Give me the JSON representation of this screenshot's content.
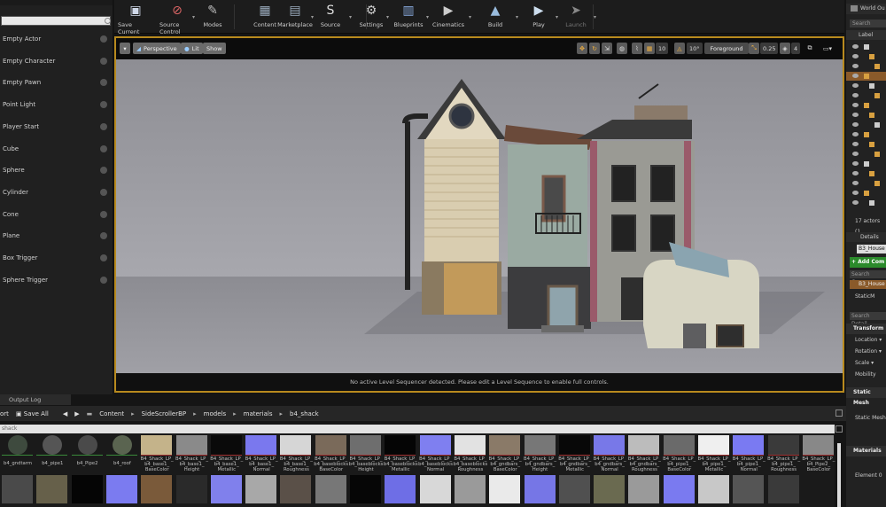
{
  "place_panel": {
    "search_placeholder": "",
    "items": [
      "Empty Actor",
      "Empty Character",
      "Empty Pawn",
      "Point Light",
      "Player Start",
      "Cube",
      "Sphere",
      "Cylinder",
      "Cone",
      "Plane",
      "Box Trigger",
      "Sphere Trigger"
    ]
  },
  "toolbar": {
    "buttons": [
      {
        "label": "Save Current",
        "icon": "save-icon"
      },
      {
        "label": "Source Control",
        "icon": "source-control-icon"
      },
      {
        "label": "Modes",
        "icon": "modes-icon"
      },
      {
        "label": "Content",
        "icon": "content-icon"
      },
      {
        "label": "Marketplace",
        "icon": "marketplace-icon"
      },
      {
        "label": "Source",
        "icon": "source-icon"
      },
      {
        "label": "Settings",
        "icon": "settings-icon"
      },
      {
        "label": "Blueprints",
        "icon": "blueprints-icon"
      },
      {
        "label": "Cinematics",
        "icon": "cinematics-icon"
      },
      {
        "label": "Build",
        "icon": "build-icon"
      },
      {
        "label": "Play",
        "icon": "play-icon"
      },
      {
        "label": "Launch",
        "icon": "launch-icon"
      }
    ]
  },
  "viewport": {
    "perspective": "Perspective",
    "lit": "Lit",
    "show": "Show",
    "grid_snap": "10",
    "rot_snap": "10°",
    "layer": "Foreground",
    "scale_snap": "0.25",
    "camera_speed": "4",
    "status_message": "No active Level Sequencer detected. Please edit a Level Sequence to enable full controls."
  },
  "world_outliner": {
    "title": "World Ou",
    "search": "Search",
    "label_col": "Label",
    "actors_count": "17 actors (1"
  },
  "details": {
    "title": "Details",
    "actor_name": "B3_House",
    "add_component": "+ Add Com",
    "search_components": "Search Comp",
    "component_root": "B3_House",
    "component_child": "StaticM",
    "search_details": "Search Detail",
    "transform": "Transform",
    "location": "Location",
    "rotation": "Rotation",
    "scale": "Scale",
    "mobility": "Mobility",
    "static_mesh_section": "Static Mesh",
    "static_mesh_row": "Static Mesh",
    "materials": "Materials",
    "element0": "Element 0"
  },
  "output_log": {
    "tab": "Output Log"
  },
  "content_browser": {
    "import_label": "ort",
    "save_all": "Save All",
    "path": [
      "Content",
      "SideScrollerBP",
      "models",
      "materials",
      "b4_shack"
    ],
    "search_value": "shack",
    "row1": [
      {
        "l1": "b4_gndtarm",
        "l2": "",
        "color": "#3e4a3e"
      },
      {
        "l1": "b4_pipe1",
        "l2": "",
        "color": "#555"
      },
      {
        "l1": "b4_Pipe2",
        "l2": "",
        "color": "#4a4a4a"
      },
      {
        "l1": "b4_roof",
        "l2": "",
        "color": "#5a6450"
      },
      {
        "l1": "B4_Shack_LP_",
        "l2": "b4_base1_",
        "l3": "BaseColor",
        "color": "#c4b38a"
      },
      {
        "l1": "B4_Shack_LP_",
        "l2": "b4_base1_",
        "l3": "Height",
        "color": "#8a8a8a"
      },
      {
        "l1": "B4_Shack_LP_",
        "l2": "b4_base1_",
        "l3": "Metallic",
        "color": "#0a0a0a"
      },
      {
        "l1": "B4_Shack_LP_",
        "l2": "b4_base1_",
        "l3": "Normal",
        "color": "#7a78ee"
      },
      {
        "l1": "B4_Shack_LP_",
        "l2": "b4_base1_",
        "l3": "Roughness",
        "color": "#d6d6d6"
      },
      {
        "l1": "B4_Shack_LP_",
        "l2": "b4_baseblocks",
        "l3": "BaseColor",
        "color": "#7a6a5a"
      },
      {
        "l1": "B4_Shack_LP_",
        "l2": "b4_baseblocks",
        "l3": "Height",
        "color": "#6e6e6e"
      },
      {
        "l1": "B4_Shack_LP_",
        "l2": "b4_baseblocks",
        "l3": "Metallic",
        "color": "#050505"
      },
      {
        "l1": "B4_Shack_LP_",
        "l2": "b4_baseblocks",
        "l3": "Normal",
        "color": "#7f7ff0"
      },
      {
        "l1": "B4_Shack_LP_",
        "l2": "b4_baseblocks",
        "l3": "Roughness",
        "color": "#e2e2e2"
      },
      {
        "l1": "B4_Shack_LP_",
        "l2": "b4_gndbars_",
        "l3": "BaseColor",
        "color": "#8a7a68"
      },
      {
        "l1": "B4_Shack_LP_",
        "l2": "b4_gndbars_",
        "l3": "Height",
        "color": "#777"
      },
      {
        "l1": "B4_Shack_LP_",
        "l2": "b4_gndbars_",
        "l3": "Metallic",
        "color": "#080808"
      },
      {
        "l1": "B4_Shack_LP_",
        "l2": "b4_gndbars_",
        "l3": "Normal",
        "color": "#7878e8"
      },
      {
        "l1": "B4_Shack_LP_",
        "l2": "b4_gndbars_",
        "l3": "Roughness",
        "color": "#bcbcbc"
      },
      {
        "l1": "B4_Shack_LP_",
        "l2": "b4_pipe1_",
        "l3": "BaseColor",
        "color": "#6a6a6a"
      },
      {
        "l1": "B4_Shack_LP_",
        "l2": "b4_pipe1_",
        "l3": "Metallic",
        "color": "#efefef"
      },
      {
        "l1": "B4_Shack_LP_",
        "l2": "b4_pipe1_",
        "l3": "Normal",
        "color": "#7a7af2"
      },
      {
        "l1": "B4_Shack_LP_",
        "l2": "b4_pipe1_",
        "l3": "Roughness",
        "color": "#3a3a3a"
      },
      {
        "l1": "B4_Shack_LP_",
        "l2": "b4_Pipe2_",
        "l3": "BaseColor",
        "color": "#888"
      }
    ],
    "row2_colors": [
      "#4a4a4a",
      "#66604a",
      "#050505",
      "#7b7bf0",
      "#7a5a3a",
      "#2a2a2a",
      "#8080ec",
      "#a8a8a8",
      "#5a5048",
      "#777",
      "#060606",
      "#6e6ee6",
      "#d8d8d8",
      "#9a9a9a",
      "#eaeaea",
      "#7676e6",
      "#505050",
      "#6a6a50",
      "#9a9a9a",
      "#7a7af0",
      "#c8c8c8",
      "#555",
      "#3a3a3a"
    ]
  }
}
